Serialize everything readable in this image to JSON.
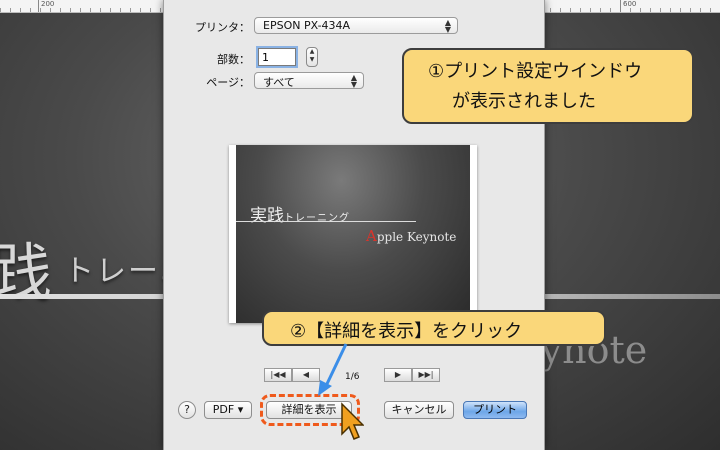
{
  "ruler": {
    "labels": [
      "200",
      "600"
    ]
  },
  "background_slide": {
    "kanji": "践",
    "small_text": "トレーニ",
    "keynote_text": "Apple Keynote"
  },
  "print_dialog": {
    "printer_label": "プリンタ：",
    "printer_value": "EPSON PX-434A",
    "copies_label": "部数：",
    "copies_value": "1",
    "pages_label": "ページ：",
    "pages_value": "すべて",
    "preview": {
      "title_big": "実践",
      "title_small": "トレーニング",
      "subtitle_first": "A",
      "subtitle_rest": "pple Keynote"
    },
    "page_count": "1/6",
    "nav": {
      "first": "|◀◀",
      "prev": "◀",
      "next": "▶",
      "last": "▶▶|"
    },
    "help_label": "?",
    "pdf_label": "PDF ▾",
    "details_label": "詳細を表示",
    "cancel_label": "キャンセル",
    "print_label": "プリント"
  },
  "callouts": {
    "one_line1": "①プリント設定ウインドウ",
    "one_line2": "が表示されました",
    "two": "②【詳細を表示】をクリック"
  },
  "colors": {
    "callout_fill": "#fad77a",
    "highlight_border": "#ef5a1c",
    "arrow": "#3b8ee8",
    "primary_button": "#6da6e8"
  }
}
